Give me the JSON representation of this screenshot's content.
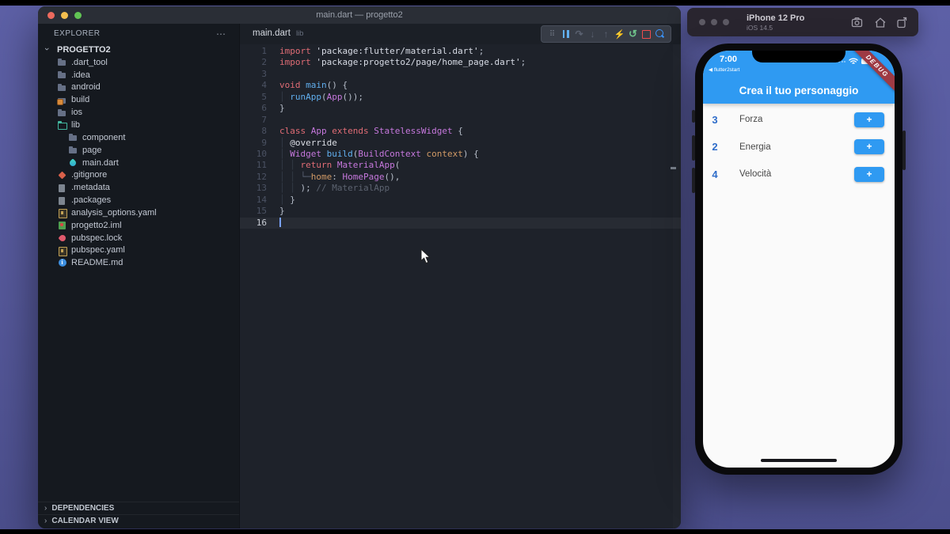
{
  "colors": {
    "accent_blue": "#2f9af2",
    "stat_number_blue": "#2e6cc9",
    "debug_red": "#9e3a44",
    "desktop_purple": "#55589a",
    "editor_bg": "#1e222a"
  },
  "vscode": {
    "window_title": "main.dart — progetto2",
    "explorer": {
      "header": "EXPLORER",
      "more_icon": "⋯",
      "tree": [
        {
          "label": "PROGETTO2",
          "icon": "chevron-down",
          "level": 0,
          "root": true
        },
        {
          "label": ".dart_tool",
          "icon": "folder",
          "level": 1
        },
        {
          "label": ".idea",
          "icon": "folder",
          "level": 1
        },
        {
          "label": "android",
          "icon": "folder",
          "level": 1
        },
        {
          "label": "build",
          "icon": "folder-lock",
          "level": 1
        },
        {
          "label": "ios",
          "icon": "folder",
          "level": 1
        },
        {
          "label": "lib",
          "icon": "folder-open-teal",
          "level": 1
        },
        {
          "label": "component",
          "icon": "folder",
          "level": 2
        },
        {
          "label": "page",
          "icon": "folder",
          "level": 2
        },
        {
          "label": "main.dart",
          "icon": "dart",
          "level": 2
        },
        {
          "label": ".gitignore",
          "icon": "git",
          "level": 1
        },
        {
          "label": ".metadata",
          "icon": "file-gray",
          "level": 1
        },
        {
          "label": ".packages",
          "icon": "file-gray",
          "level": 1
        },
        {
          "label": "analysis_options.yaml",
          "icon": "yaml",
          "level": 1
        },
        {
          "label": "progetto2.iml",
          "icon": "iml",
          "level": 1
        },
        {
          "label": "pubspec.lock",
          "icon": "pub",
          "level": 1
        },
        {
          "label": "pubspec.yaml",
          "icon": "yaml",
          "level": 1
        },
        {
          "label": "README.md",
          "icon": "info",
          "level": 1
        }
      ],
      "bottom_sections": [
        {
          "label": "DEPENDENCIES",
          "chevron": "›"
        },
        {
          "label": "CALENDAR VIEW",
          "chevron": "›"
        }
      ]
    },
    "tab": {
      "name": "main.dart",
      "hint": "lib"
    },
    "debug_toolbar": [
      {
        "name": "grip-handle",
        "glyph": "⠿",
        "cls": "grip",
        "interactable": true
      },
      {
        "name": "pause",
        "shape": "pause",
        "interactable": true
      },
      {
        "name": "step-over",
        "glyph": "↷",
        "cls": "step",
        "interactable": true
      },
      {
        "name": "step-into",
        "glyph": "↓",
        "cls": "step",
        "interactable": true
      },
      {
        "name": "step-out",
        "glyph": "↑",
        "cls": "step",
        "interactable": true
      },
      {
        "name": "hot-reload",
        "glyph": "⚡",
        "cls": "hot",
        "interactable": true
      },
      {
        "name": "restart",
        "glyph": "↺",
        "cls": "restart",
        "interactable": true
      },
      {
        "name": "stop",
        "shape": "stop",
        "interactable": true
      },
      {
        "name": "widget-inspector",
        "shape": "search",
        "interactable": true
      }
    ],
    "code": {
      "lines": [
        {
          "n": "1",
          "t": [
            [
              "kw",
              "import"
            ],
            [
              "punct",
              " "
            ],
            [
              "str",
              "'package:flutter/material.dart'"
            ],
            [
              "punct",
              ";"
            ]
          ]
        },
        {
          "n": "2",
          "t": [
            [
              "kw",
              "import"
            ],
            [
              "punct",
              " "
            ],
            [
              "str",
              "'package:progetto2/page/home_page.dart'"
            ],
            [
              "punct",
              ";"
            ]
          ]
        },
        {
          "n": "3",
          "t": []
        },
        {
          "n": "4",
          "t": [
            [
              "kw",
              "void"
            ],
            [
              "punct",
              " "
            ],
            [
              "fn",
              "main"
            ],
            [
              "punct",
              "() {"
            ]
          ]
        },
        {
          "n": "5",
          "t": [
            [
              "guide",
              "│ "
            ],
            [
              "fn",
              "runApp"
            ],
            [
              "punct",
              "("
            ],
            [
              "type",
              "App"
            ],
            [
              "punct",
              "());"
            ]
          ]
        },
        {
          "n": "6",
          "t": [
            [
              "punct",
              "}"
            ]
          ]
        },
        {
          "n": "7",
          "t": []
        },
        {
          "n": "8",
          "t": [
            [
              "kw",
              "class"
            ],
            [
              "punct",
              " "
            ],
            [
              "type",
              "App"
            ],
            [
              "punct",
              " "
            ],
            [
              "kw",
              "extends"
            ],
            [
              "punct",
              " "
            ],
            [
              "type",
              "StatelessWidget"
            ],
            [
              "punct",
              " {"
            ]
          ]
        },
        {
          "n": "9",
          "t": [
            [
              "guide",
              "│ "
            ],
            [
              "ann",
              "@override"
            ]
          ]
        },
        {
          "n": "10",
          "t": [
            [
              "guide",
              "│ "
            ],
            [
              "type",
              "Widget"
            ],
            [
              "punct",
              " "
            ],
            [
              "fn",
              "build"
            ],
            [
              "punct",
              "("
            ],
            [
              "type",
              "BuildContext"
            ],
            [
              "punct",
              " "
            ],
            [
              "attr",
              "context"
            ],
            [
              "punct",
              ") {"
            ]
          ]
        },
        {
          "n": "11",
          "t": [
            [
              "guide",
              "│ │ "
            ],
            [
              "kw",
              "return"
            ],
            [
              "punct",
              " "
            ],
            [
              "type",
              "MaterialApp"
            ],
            [
              "punct",
              "("
            ]
          ]
        },
        {
          "n": "12",
          "t": [
            [
              "guide",
              "│ │ "
            ],
            [
              "guide2",
              "└─"
            ],
            [
              "attr",
              "home"
            ],
            [
              "punct",
              ": "
            ],
            [
              "type",
              "HomePage"
            ],
            [
              "punct",
              "(),"
            ]
          ]
        },
        {
          "n": "13",
          "t": [
            [
              "guide",
              "│ │ "
            ],
            [
              "punct",
              "); "
            ],
            [
              "cmt",
              "// MaterialApp"
            ]
          ]
        },
        {
          "n": "14",
          "t": [
            [
              "guide",
              "│ "
            ],
            [
              "punct",
              "}"
            ]
          ]
        },
        {
          "n": "15",
          "t": [
            [
              "punct",
              "}"
            ]
          ]
        },
        {
          "n": "16",
          "t": [],
          "active": true
        }
      ]
    }
  },
  "simulator": {
    "window_title": "iPhone 12 Pro",
    "window_subtitle": "iOS 14.5",
    "statusbar": {
      "time": "7:00",
      "back_glyph": "◀",
      "carrier": "flutter2start"
    },
    "debug_badge": "DEBUG",
    "appbar_title": "Crea il tuo personaggio",
    "stats": [
      {
        "value": "3",
        "label": "Forza",
        "button": "+"
      },
      {
        "value": "2",
        "label": "Energia",
        "button": "+"
      },
      {
        "value": "4",
        "label": "Velocità",
        "button": "+"
      }
    ]
  }
}
